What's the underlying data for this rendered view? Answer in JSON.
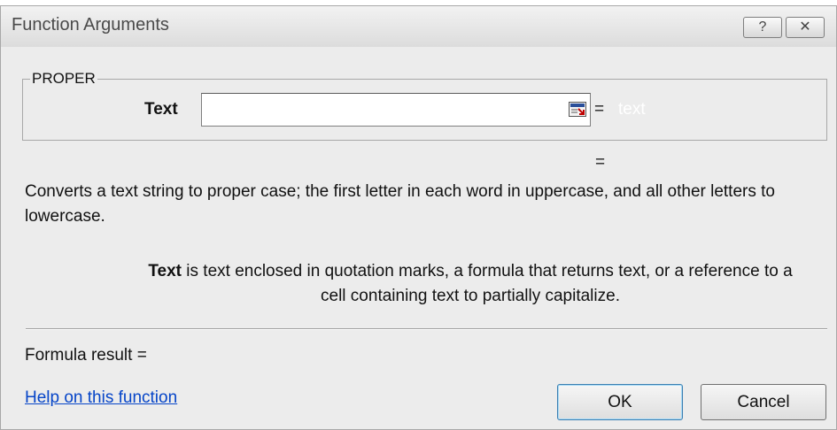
{
  "dialog": {
    "title": "Function Arguments",
    "help_button": "?",
    "close_button": "✕"
  },
  "function": {
    "name": "PROPER",
    "argument": {
      "label": "Text",
      "value": "",
      "result": "text"
    },
    "equals": "=",
    "description": "Converts a text string to proper case; the first letter in each word in uppercase, and all other letters to lowercase.",
    "argument_help": {
      "name": "Text",
      "text": " is text enclosed in quotation marks, a formula that returns text, or a reference to a cell containing text to partially capitalize."
    }
  },
  "footer": {
    "formula_result": "Formula result =",
    "help_link": "Help on this function",
    "ok_label": "OK",
    "cancel_label": "Cancel"
  },
  "colors": {
    "dialog_bg": "#ececec",
    "link": "#0645c8",
    "collapse_icon_accent": "#c00000"
  }
}
